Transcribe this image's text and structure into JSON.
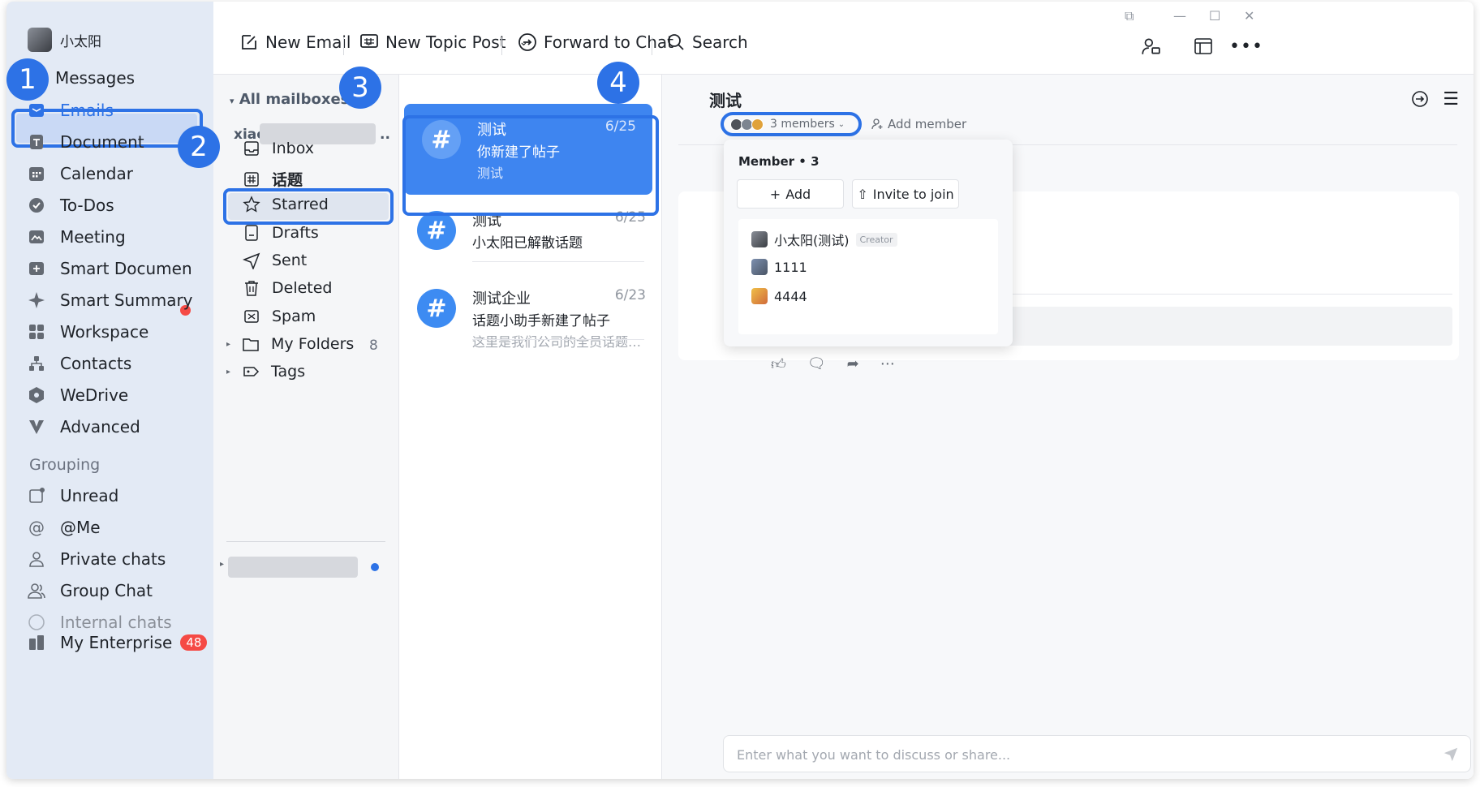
{
  "window": {
    "controls": [
      "⧉",
      "—",
      "☐",
      "✕"
    ]
  },
  "user": {
    "name": "小太阳"
  },
  "sidebar": {
    "items": [
      {
        "label": "Messages"
      },
      {
        "label": "Emails"
      },
      {
        "label": "Document"
      },
      {
        "label": "Calendar"
      },
      {
        "label": "To-Dos"
      },
      {
        "label": "Meeting"
      },
      {
        "label": "Smart Documen"
      },
      {
        "label": "Smart Summary"
      },
      {
        "label": "Workspace"
      },
      {
        "label": "Contacts"
      },
      {
        "label": "WeDrive"
      },
      {
        "label": "Advanced"
      }
    ],
    "grouping_heading": "Grouping",
    "groups": [
      {
        "label": "Unread"
      },
      {
        "label": "@Me"
      },
      {
        "label": "Private chats"
      },
      {
        "label": "Group Chat"
      },
      {
        "label": "Internal chats"
      },
      {
        "label": "My Enterprise",
        "badge": "48"
      }
    ]
  },
  "steps": [
    "1",
    "2",
    "3",
    "4"
  ],
  "toolbar": {
    "new_email": "New Email",
    "new_topic_post": "New Topic Post",
    "forward_to_chat": "Forward to Chat",
    "search": "Search"
  },
  "mailboxes": {
    "title": "All mailboxes",
    "account_prefix": "xiac",
    "account_suffix": "..",
    "items": [
      {
        "label": "Inbox"
      },
      {
        "label": "话题"
      },
      {
        "label": "Starred"
      },
      {
        "label": "Drafts"
      },
      {
        "label": "Sent"
      },
      {
        "label": "Deleted"
      },
      {
        "label": "Spam"
      },
      {
        "label": "My Folders",
        "count": "8"
      },
      {
        "label": "Tags"
      }
    ]
  },
  "list": {
    "items": [
      {
        "title": "测试",
        "line2": "你新建了帖子",
        "line3": "测试",
        "date": "6/25"
      },
      {
        "title": "测试",
        "line2": "小太阳已解散话题",
        "line3": "",
        "date": "6/25"
      },
      {
        "title": "测试企业",
        "line2": "话题小助手新建了帖子",
        "line3": "这里是我们公司的全员话题，话...",
        "date": "6/23"
      }
    ]
  },
  "detail": {
    "title": "测试",
    "members_pill": "3 members",
    "add_member": "Add member",
    "composer_placeholder": "Enter what you want to discuss or share...",
    "popup": {
      "title": "Member • 3",
      "add": "Add",
      "invite": "Invite to join",
      "members": [
        {
          "name": "小太阳(测试)",
          "tag": "Creator"
        },
        {
          "name": "1111",
          "tag": ""
        },
        {
          "name": "4444",
          "tag": ""
        }
      ]
    }
  },
  "colors": {
    "accent": "#2d72e6",
    "sidebar_bg": "#e3eaf5",
    "selected_item": "#3e85f0",
    "badge": "#f54a45"
  }
}
